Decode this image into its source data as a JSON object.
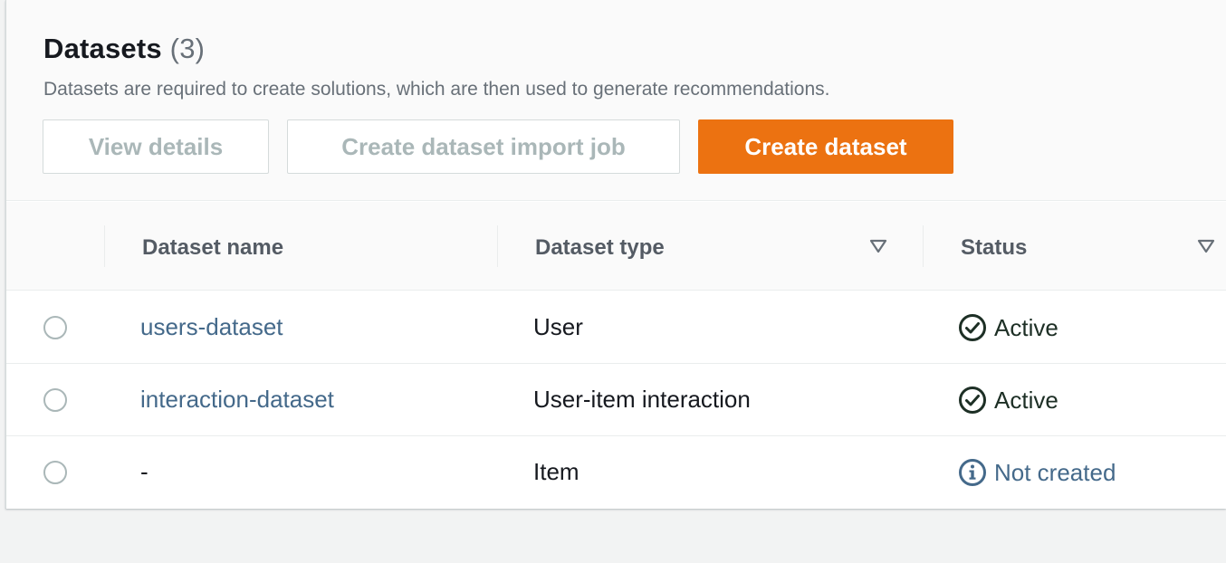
{
  "panel": {
    "title": "Datasets",
    "count": "(3)",
    "description": "Datasets are required to create solutions, which are then used to generate recommendations."
  },
  "actions": {
    "view_details": "View details",
    "create_import_job": "Create dataset import job",
    "create_dataset": "Create dataset"
  },
  "table": {
    "columns": {
      "name": "Dataset name",
      "type": "Dataset type",
      "status": "Status"
    },
    "rows": [
      {
        "name": "users-dataset",
        "type": "User",
        "status": "Active",
        "status_icon": "check-circle-icon"
      },
      {
        "name": "interaction-dataset",
        "type": "User-item interaction",
        "status": "Active",
        "status_icon": "check-circle-icon"
      },
      {
        "name": "-",
        "type": "Item",
        "status": "Not created",
        "status_icon": "info-circle-icon"
      }
    ]
  },
  "colors": {
    "primary": "#ec7211",
    "link": "#44698a",
    "success": "#1d2f25",
    "disabled_text": "#aab7b8"
  }
}
